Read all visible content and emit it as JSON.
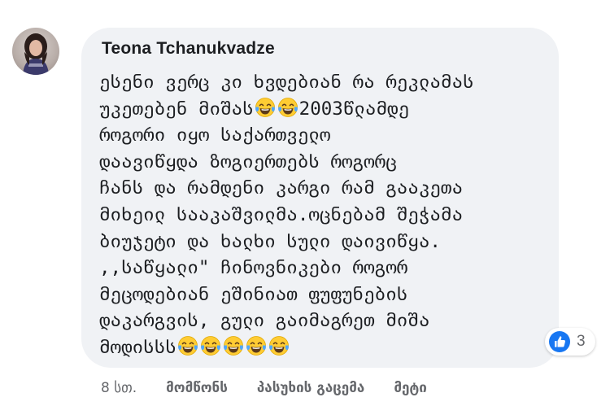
{
  "comment": {
    "author": "Teona Tchanukvadze",
    "lines": [
      "ესენი ვერც კი ხვდებიან რა რეკლამას",
      "უკეთებენ მიშას",
      "როგორი იყო საქართველო",
      "დაავიწყდა ზოგიერთებს როგორც",
      "ჩანს და რამდენი კარგი რამ გააკეთა",
      "მიხეილ სააკაშვილმა.ოცნებამ შეჭამა",
      "ბიუჯეტი და ხალხი სული დაივიწყა.",
      ",,საწყალი\" ჩინოვნიკები როგორ",
      "მეცოდებიან ეშინიათ ფუფუნების",
      "დაკარგვის, გული გაიმაგრეთ მიშა",
      "მოდისსს"
    ],
    "line2_suffix": "2003წლამდე",
    "emoji": "face-with-tears-of-joy",
    "reactions": {
      "icon": "like-icon",
      "count": "3",
      "color": "#1877f2"
    },
    "timestamp": "8 სთ.",
    "actions": {
      "like": "მომწონს",
      "reply": "პასუხის გაცემა",
      "more": "მეტი"
    }
  }
}
